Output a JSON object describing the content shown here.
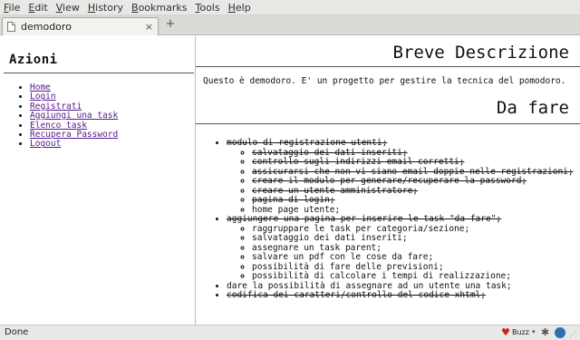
{
  "menubar": {
    "items": [
      "File",
      "Edit",
      "View",
      "History",
      "Bookmarks",
      "Tools",
      "Help"
    ]
  },
  "tab": {
    "title": "demodoro",
    "close_glyph": "×",
    "new_tab_glyph": "+"
  },
  "sidebar": {
    "title": "Azioni",
    "links": [
      "Home",
      "Login",
      "Registrati",
      "Aggiungi una task",
      "Elenco task",
      "Recupera Password",
      "Logout"
    ]
  },
  "main": {
    "heading1": "Breve Descrizione",
    "description": "Questo è demodoro. E' un progetto per gestire la tecnica del pomodoro.",
    "heading2": "Da fare",
    "todo": [
      {
        "text": "modulo di registrazione utenti;",
        "done": true,
        "sub": [
          {
            "text": "salvataggio dei dati inseriti;",
            "done": true
          },
          {
            "text": "controllo sugli indirizzi email corretti;",
            "done": true
          },
          {
            "text": "assicurarsi che non vi siano email doppie nelle registrazioni;",
            "done": true
          },
          {
            "text": "creare il modulo per generare/recuperare la password;",
            "done": true
          },
          {
            "text": "creare un utente amministratore;",
            "done": true
          },
          {
            "text": "pagina di login;",
            "done": true
          },
          {
            "text": "home page utente;",
            "done": false
          }
        ]
      },
      {
        "text": "aggiungere una pagina per inserire le task \"da fare\";",
        "done": true,
        "sub": [
          {
            "text": "raggruppare le task per categoria/sezione;",
            "done": false
          },
          {
            "text": "salvataggio dei dati inseriti;",
            "done": false
          },
          {
            "text": "assegnare un task parent;",
            "done": false
          },
          {
            "text": "salvare un pdf con le cose da fare;",
            "done": false
          },
          {
            "text": "possibilità di fare delle previsioni;",
            "done": false
          },
          {
            "text": "possibilità di calcolare i tempi di realizzazione;",
            "done": false
          }
        ]
      },
      {
        "text": "dare la possibilità di assegnare ad un utente una task;",
        "done": false,
        "sub": []
      },
      {
        "text": "codifica dei caratteri/controllo del codice xhtml;",
        "done": true,
        "sub": []
      }
    ]
  },
  "statusbar": {
    "status": "Done",
    "buzz_label": "Buzz",
    "dropdown_glyph": "▾"
  },
  "icons": {
    "tab_page": "page-icon",
    "heart": "heart-icon",
    "gear": "gear-icon",
    "mozilla": "mozilla-icon",
    "resize": "resize-grip-icon"
  },
  "colors": {
    "visited_link": "#551a8b",
    "heart": "#d0201a"
  }
}
